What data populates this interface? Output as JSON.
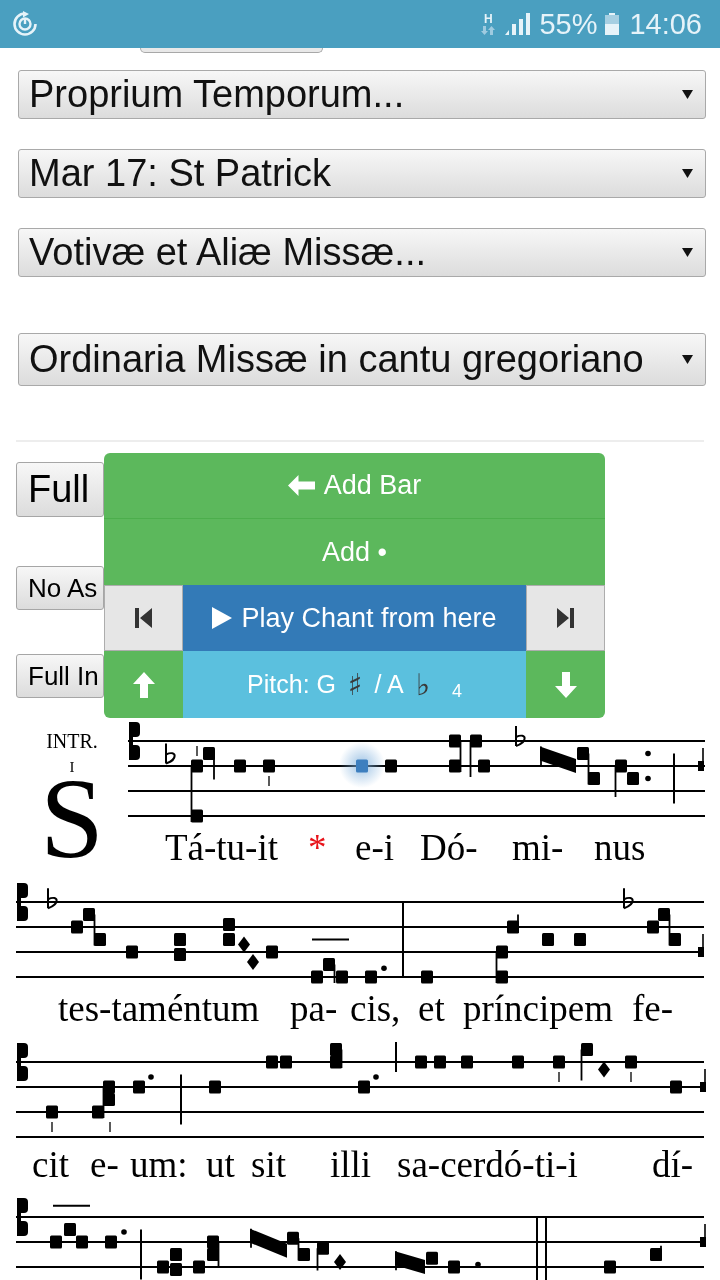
{
  "status_bar": {
    "network_type": "H",
    "battery": "55%",
    "time": "14:06"
  },
  "propers_selects": [
    {
      "value": "Proprium Temporum..."
    },
    {
      "value": "Mar 17: St Patrick"
    },
    {
      "value": "Votivæ et Aliæ Missæ..."
    }
  ],
  "ordinary_select": {
    "value": "Ordinaria Missæ in cantu gregoriano"
  },
  "main_button": {
    "label": "Full"
  },
  "option_buttons": [
    {
      "label": "No As"
    },
    {
      "label": "Full In"
    }
  ],
  "popup": {
    "add_bar": "Add Bar",
    "add_neume": "Add •",
    "play": "Play Chant from here",
    "pitch": {
      "label": "Pitch: G",
      "sharp": "♯",
      "alternate": "/ A",
      "flat": "♭",
      "octave": "4"
    }
  },
  "score": {
    "mode": "INTR.",
    "mode_number": "I",
    "initial": "S",
    "lyric_lines": [
      [
        {
          "text": "Tá-tu-it",
          "kind": "syllable"
        },
        {
          "text": "*",
          "kind": "asterisk"
        },
        {
          "text": "e-i",
          "kind": "syllable"
        },
        {
          "text": "Dó-",
          "kind": "syllable"
        },
        {
          "text": "mi-",
          "kind": "syllable"
        },
        {
          "text": "nus",
          "kind": "syllable"
        }
      ],
      [
        {
          "text": "tes-taméntum",
          "kind": "syllable"
        },
        {
          "text": "pa-",
          "kind": "syllable"
        },
        {
          "text": "cis,",
          "kind": "syllable"
        },
        {
          "text": "et",
          "kind": "syllable"
        },
        {
          "text": "príncipem",
          "kind": "syllable"
        },
        {
          "text": "fe-",
          "kind": "syllable"
        }
      ],
      [
        {
          "text": "cit",
          "kind": "syllable"
        },
        {
          "text": "e-",
          "kind": "syllable"
        },
        {
          "text": "um:",
          "kind": "syllable"
        },
        {
          "text": "ut",
          "kind": "syllable"
        },
        {
          "text": "sit",
          "kind": "syllable"
        },
        {
          "text": "illi",
          "kind": "syllable"
        },
        {
          "text": "sa-cerdó-ti-i",
          "kind": "syllable"
        },
        {
          "text": "dí-",
          "kind": "syllable"
        }
      ]
    ]
  }
}
